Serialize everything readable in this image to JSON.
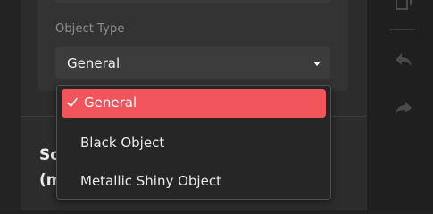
{
  "object_type": {
    "label": "Object Type",
    "selected_value": "General"
  },
  "dropdown": {
    "options": [
      {
        "label": "General",
        "selected": true
      },
      {
        "label": "Black Object",
        "selected": false
      },
      {
        "label": "Metallic Shiny Object",
        "selected": false
      }
    ]
  },
  "section": {
    "heading_line1": "Sc",
    "heading_line2": "(m"
  },
  "toolbar": {
    "icons": [
      "pages-icon",
      "undo-icon",
      "redo-icon"
    ]
  },
  "colors": {
    "accent": "#f2545b",
    "panel_bg": "#2c2c2c",
    "menu_bg": "#262626"
  }
}
